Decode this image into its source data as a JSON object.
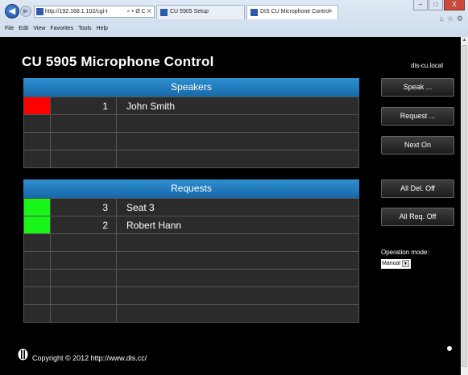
{
  "browser": {
    "address": "http://192.168.1.102/cgi-t",
    "address_controls": "⌕ ▾ Ø C ✕",
    "tabs": [
      {
        "label": "CU 5905 Setup"
      },
      {
        "label": "DIS CU Microphone Control",
        "close": "×"
      }
    ],
    "menu": [
      "File",
      "Edit",
      "View",
      "Favorites",
      "Tools",
      "Help"
    ],
    "window_controls": {
      "minimize": "–",
      "maximize": "□",
      "close": "X"
    },
    "nav_icons": [
      "home-icon",
      "star-icon",
      "gear-icon"
    ]
  },
  "page": {
    "title": "CU 5905 Microphone Control",
    "hostname": "dis-cu.local",
    "speakers": {
      "header": "Speakers",
      "rows": [
        {
          "status": "red",
          "number": "1",
          "name": "John Smith"
        },
        {
          "status": "",
          "number": "",
          "name": ""
        },
        {
          "status": "",
          "number": "",
          "name": ""
        },
        {
          "status": "",
          "number": "",
          "name": ""
        }
      ]
    },
    "requests": {
      "header": "Requests",
      "rows": [
        {
          "status": "green",
          "number": "3",
          "name": "Seat 3"
        },
        {
          "status": "green",
          "number": "2",
          "name": "Robert Hann"
        },
        {
          "status": "",
          "number": "",
          "name": ""
        },
        {
          "status": "",
          "number": "",
          "name": ""
        },
        {
          "status": "",
          "number": "",
          "name": ""
        },
        {
          "status": "",
          "number": "",
          "name": ""
        },
        {
          "status": "",
          "number": "",
          "name": ""
        }
      ]
    },
    "buttons": {
      "speak": "Speak ...",
      "request": "Request ...",
      "next_on": "Next On",
      "all_del_off": "All Del. Off",
      "all_req_off": "All Req. Off"
    },
    "operation_mode": {
      "label": "Operation mode:",
      "value": "Manual"
    },
    "footer": {
      "copyright": "Copyright © 2012 http://www.dis.cc/"
    },
    "colors": {
      "header_blue": "#1f7bbf",
      "status_red": "#ff0000",
      "status_green": "#19f519"
    }
  }
}
